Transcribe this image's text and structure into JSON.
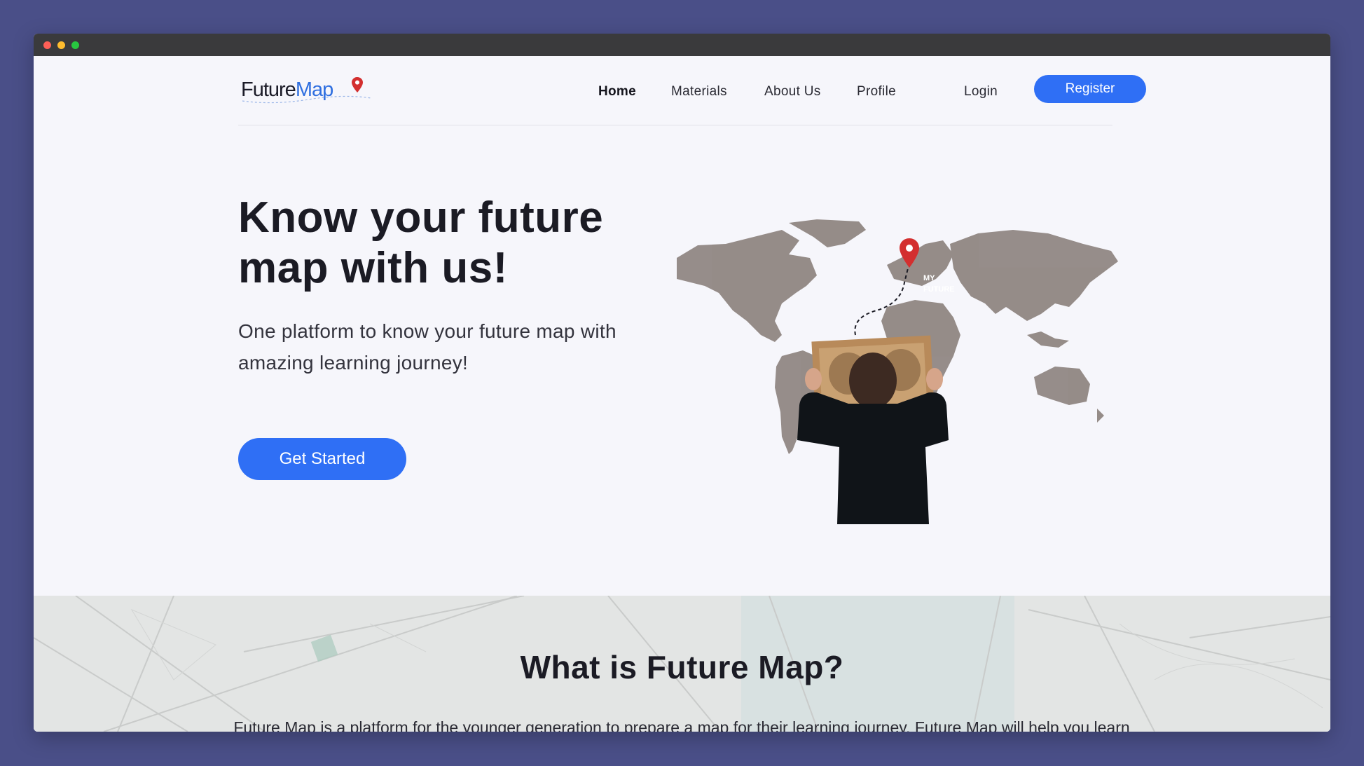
{
  "logo": {
    "part1": "Future",
    "part2": "Map"
  },
  "nav": {
    "links": [
      "Home",
      "Materials",
      "About Us",
      "Profile"
    ],
    "login": "Login",
    "register": "Register"
  },
  "hero": {
    "title_line1": "Know your future",
    "title_line2": "map with us!",
    "subtitle": "One platform to know your future map with amazing learning journey!",
    "cta": "Get Started",
    "map_label_line1": "MY",
    "map_label_line2": "FUTURE"
  },
  "about": {
    "title": "What is Future Map?",
    "text": "Future Map is a platform for the younger generation to prepare a map for their learning journey. Future Map will help you learn the basic things that must be designed before entering college according to your major. Likewise, with"
  },
  "colors": {
    "accent": "#2f6ff5",
    "background": "#f6f6fb",
    "frame": "#4a4f88",
    "pin": "#d32f2f"
  }
}
